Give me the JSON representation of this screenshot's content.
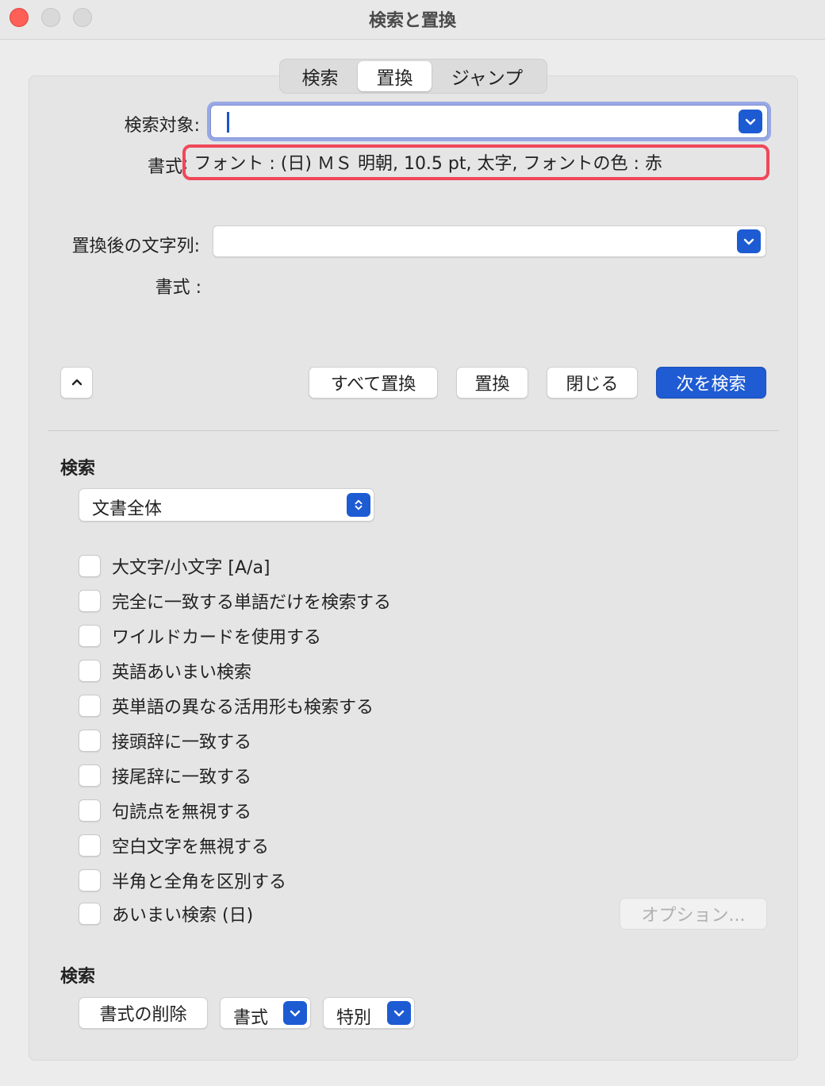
{
  "window": {
    "title": "検索と置換"
  },
  "tabs": [
    {
      "label": "検索"
    },
    {
      "label": "置換"
    },
    {
      "label": "ジャンプ"
    }
  ],
  "find": {
    "label": "検索対象:",
    "value": "",
    "format_label": "書式",
    "format_value": ":  フォント : (日) ＭＳ 明朝, 10.5 pt, 太字, フォントの色 : 赤"
  },
  "replace": {
    "label": "置換後の文字列:",
    "value": "",
    "format_label": "書式 :"
  },
  "actions": {
    "replace_all": "すべて置換",
    "replace": "置換",
    "close": "閉じる",
    "find_next": "次を検索"
  },
  "search_section": {
    "title": "検索",
    "scope_selected": "文書全体",
    "options": [
      {
        "label": "大文字/小文字 [A/a]",
        "checked": false
      },
      {
        "label": "完全に一致する単語だけを検索する",
        "checked": false
      },
      {
        "label": "ワイルドカードを使用する",
        "checked": false
      },
      {
        "label": "英語あいまい検索",
        "checked": false
      },
      {
        "label": "英単語の異なる活用形も検索する",
        "checked": false
      },
      {
        "label": "接頭辞に一致する",
        "checked": false
      },
      {
        "label": "接尾辞に一致する",
        "checked": false
      },
      {
        "label": "句読点を無視する",
        "checked": false
      },
      {
        "label": "空白文字を無視する",
        "checked": false
      },
      {
        "label": "半角と全角を区別する",
        "checked": false
      },
      {
        "label": "あいまい検索 (日)",
        "checked": false
      }
    ],
    "options_button": "オプション..."
  },
  "bottom_section": {
    "title": "検索",
    "clear_format": "書式の削除",
    "format": "書式",
    "special": "特別"
  },
  "colors": {
    "accent": "#1f5bd3",
    "highlight": "#f0485a",
    "close_button": "#fe5f57"
  }
}
